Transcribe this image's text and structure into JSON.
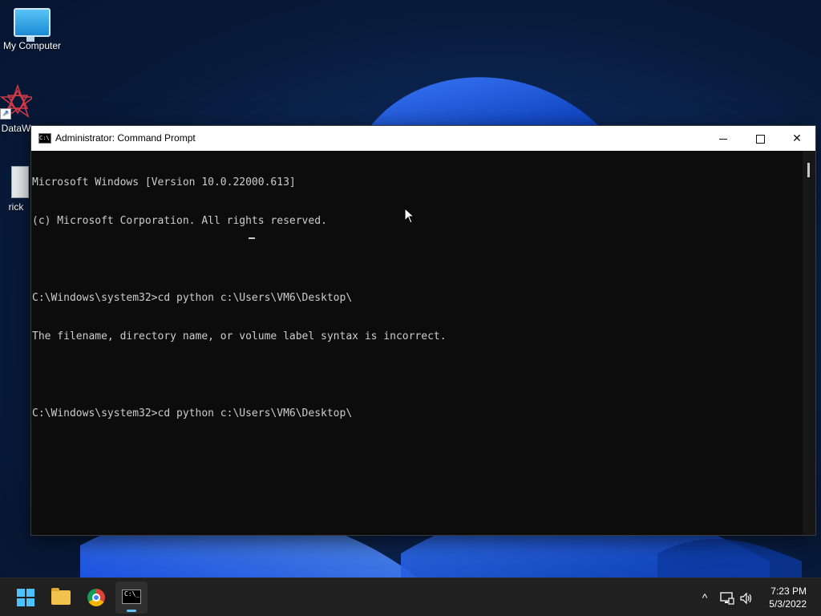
{
  "desktop": {
    "icons": [
      {
        "label": "My Computer",
        "icon": "monitor-icon"
      },
      {
        "label": "DataW",
        "icon": "star-app-icon"
      },
      {
        "label": "rick",
        "icon": "document-icon"
      }
    ]
  },
  "window": {
    "title": "Administrator: Command Prompt",
    "minimize": "minimize",
    "maximize": "maximize",
    "close": "✕"
  },
  "console": {
    "lines": [
      "Microsoft Windows [Version 10.0.22000.613]",
      "(c) Microsoft Corporation. All rights reserved.",
      "",
      "C:\\Windows\\system32>cd python c:\\Users\\VM6\\Desktop\\",
      "The filename, directory name, or volume label syntax is incorrect.",
      "",
      "C:\\Windows\\system32>cd python c:\\Users\\VM6\\Desktop\\"
    ]
  },
  "taskbar": {
    "apps": [
      "start-icon",
      "file-explorer-icon",
      "chrome-icon",
      "command-prompt-icon"
    ],
    "tray": {
      "chevron": "^",
      "network": "network-icon",
      "volume": "volume-icon"
    },
    "time": "7:23 PM",
    "date": "5/3/2022"
  },
  "colors": {
    "console_bg": "#0c0c0c",
    "console_text": "#cccccc",
    "taskbar_bg": "#202020",
    "accent": "#4cc2ff"
  }
}
